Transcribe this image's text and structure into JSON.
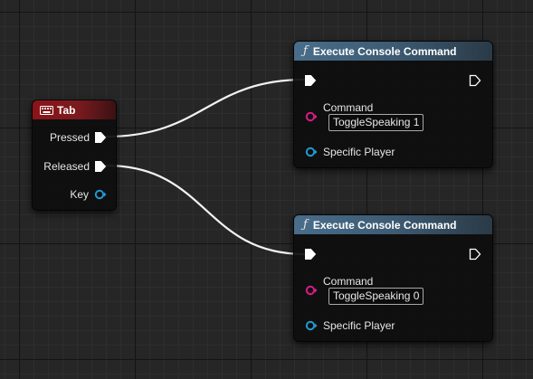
{
  "input_event_node": {
    "title": "Tab",
    "icon": "keyboard-icon",
    "header_color": "#8b1419",
    "pins": {
      "pressed": "Pressed",
      "released": "Released",
      "key": "Key"
    }
  },
  "console_command_nodes": [
    {
      "title": "Execute Console Command",
      "icon": "function-icon",
      "command_label": "Command",
      "command_value": "ToggleSpeaking 1",
      "player_label": "Specific Player"
    },
    {
      "title": "Execute Console Command",
      "icon": "function-icon",
      "command_label": "Command",
      "command_value": "ToggleSpeaking 0",
      "player_label": "Specific Player"
    }
  ],
  "colors": {
    "exec_pin": "#ffffff",
    "string_pin": "#d81b86",
    "object_pin": "#1f9ad6",
    "struct_pin": "#1f9ad6",
    "function_header": "#496d8a"
  }
}
